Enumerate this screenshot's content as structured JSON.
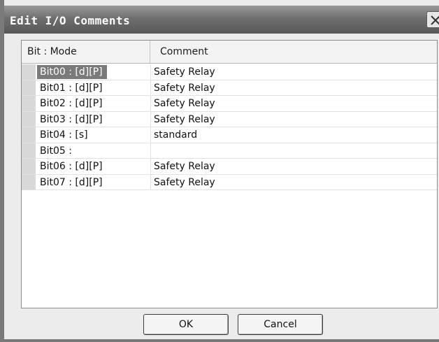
{
  "window": {
    "title": "Edit I/O Comments"
  },
  "listview": {
    "columns": [
      "Bit : Mode",
      "Comment"
    ],
    "rows": [
      {
        "bit": "Bit00 : [d][P]",
        "comment": "Safety Relay",
        "selected": true
      },
      {
        "bit": "Bit01 : [d][P]",
        "comment": "Safety Relay",
        "selected": false
      },
      {
        "bit": "Bit02 : [d][P]",
        "comment": "Safety Relay",
        "selected": false
      },
      {
        "bit": "Bit03 : [d][P]",
        "comment": "Safety Relay",
        "selected": false
      },
      {
        "bit": "Bit04 : [s]",
        "comment": "standard",
        "selected": false
      },
      {
        "bit": "Bit05 :",
        "comment": "",
        "selected": false
      },
      {
        "bit": "Bit06 : [d][P]",
        "comment": "Safety Relay",
        "selected": false
      },
      {
        "bit": "Bit07 : [d][P]",
        "comment": "Safety Relay",
        "selected": false
      }
    ]
  },
  "buttons": {
    "ok_label": "OK",
    "cancel_label": "Cancel"
  },
  "icons": {
    "close": "close-icon"
  }
}
